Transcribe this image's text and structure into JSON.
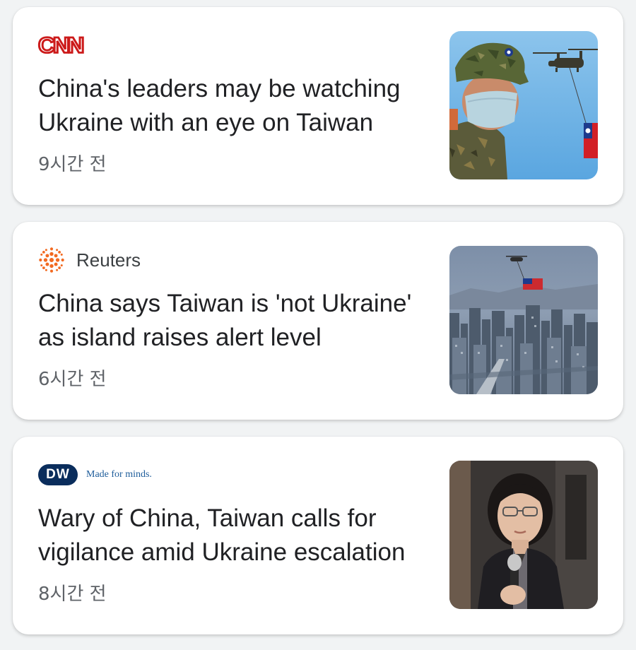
{
  "feed": {
    "articles": [
      {
        "source": "CNN",
        "source_logo_icon": "cnn-logo",
        "brand_color": "#cc1a1a",
        "headline": "China's leaders may be watching Ukraine with an eye on Taiwan",
        "time": "9시간 전",
        "thumbnail": "soldier-and-helicopter-with-taiwan-flag"
      },
      {
        "source": "Reuters",
        "source_logo_icon": "reuters-logo",
        "brand_color": "#f26a21",
        "headline": "China says Taiwan is 'not Ukraine' as island raises alert level",
        "time": "6시간 전",
        "thumbnail": "city-skyline-with-flag-helicopter"
      },
      {
        "source": "DW",
        "source_tagline": "Made for minds.",
        "source_logo_icon": "dw-logo",
        "brand_color": "#0a2d5c",
        "headline": "Wary of China, Taiwan calls for vigilance amid Ukraine escalation",
        "time": "8시간 전",
        "thumbnail": "woman-speaking-at-microphone"
      }
    ]
  }
}
